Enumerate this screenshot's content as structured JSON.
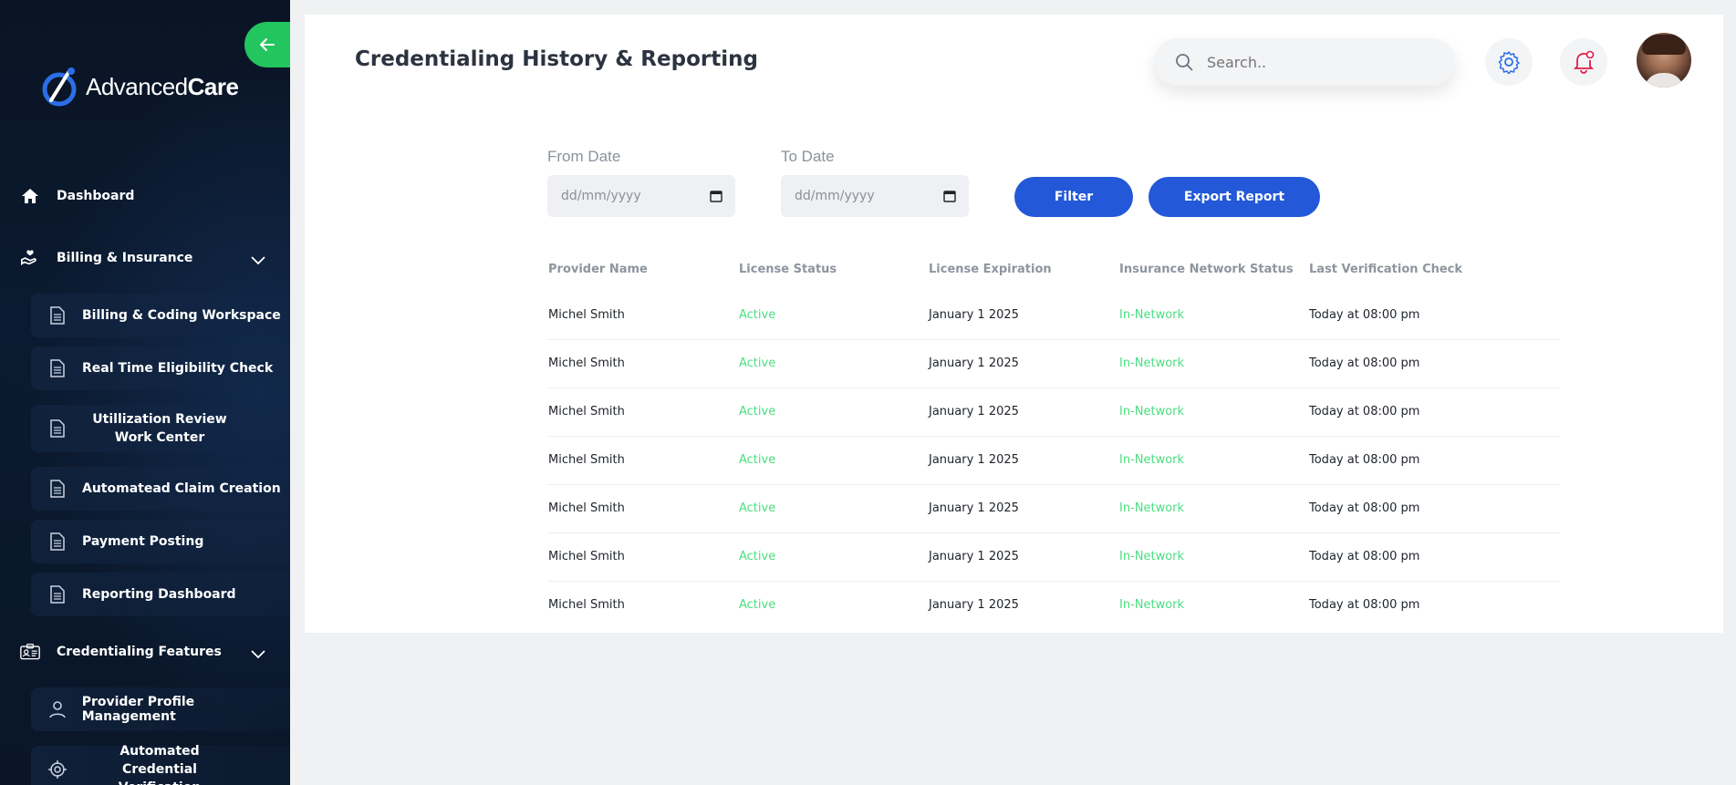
{
  "app": {
    "logo": {
      "part1": "Advanced",
      "part2": "Care"
    }
  },
  "sidebar": {
    "dashboard": "Dashboard",
    "billing_group": "Billing & Insurance",
    "billing_items": [
      {
        "label": "Billing & Coding Workspace",
        "icon": "document-icon"
      },
      {
        "label": "Real Time Eligibility Check",
        "icon": "document-icon"
      },
      {
        "label": "Utillization Review Work Center",
        "icon": "document-icon"
      },
      {
        "label": "Automatead Claim Creation",
        "icon": "document-icon"
      },
      {
        "label": "Payment Posting",
        "icon": "document-icon"
      },
      {
        "label": "Reporting Dashboard",
        "icon": "document-icon"
      }
    ],
    "credentialing_group": "Credentialing Features",
    "credentialing_items": [
      {
        "label": "Provider Profile Management",
        "icon": "user-icon"
      },
      {
        "label": "Automated Credential Verification",
        "icon": "target-icon"
      }
    ]
  },
  "header": {
    "title": "Credentialing History & Reporting",
    "search_placeholder": "Search.."
  },
  "filters": {
    "from_label": "From Date",
    "to_label": "To Date",
    "from_placeholder": "dd/mm/yyyy",
    "to_placeholder": "dd/mm/yyyy",
    "filter_button": "Filter",
    "export_button": "Export Report"
  },
  "table": {
    "columns": [
      "Provider Name",
      "License Status",
      "License Expiration",
      "Insurance Network Status",
      "Last Verification Check"
    ],
    "rows": [
      [
        "Michel Smith",
        "Active",
        "January 1 2025",
        "In-Network",
        "Today at 08:00 pm"
      ],
      [
        "Michel Smith",
        "Active",
        "January 1 2025",
        "In-Network",
        "Today at 08:00 pm"
      ],
      [
        "Michel Smith",
        "Active",
        "January 1 2025",
        "In-Network",
        "Today at 08:00 pm"
      ],
      [
        "Michel Smith",
        "Active",
        "January 1 2025",
        "In-Network",
        "Today at 08:00 pm"
      ],
      [
        "Michel Smith",
        "Active",
        "January 1 2025",
        "In-Network",
        "Today at 08:00 pm"
      ],
      [
        "Michel Smith",
        "Active",
        "January 1 2025",
        "In-Network",
        "Today at 08:00 pm"
      ],
      [
        "Michel Smith",
        "Active",
        "January 1 2025",
        "In-Network",
        "Today at 08:00 pm"
      ]
    ]
  },
  "colors": {
    "accent": "#2358d8",
    "sidebar_bg": "#0a1424",
    "collapse_green": "#22c55e",
    "status_green": "#4ade80",
    "notification_red": "#e11d48"
  }
}
